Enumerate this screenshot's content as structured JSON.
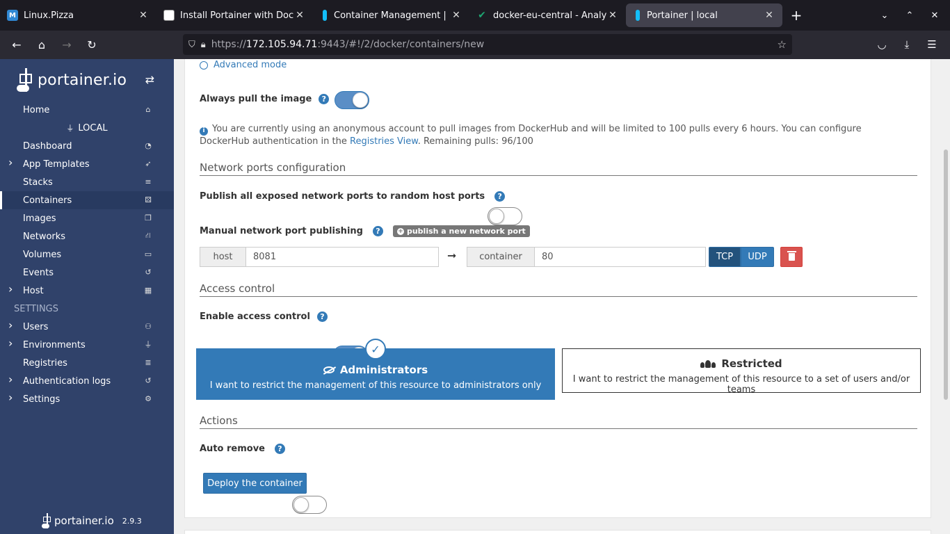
{
  "browser": {
    "tabs": [
      {
        "title": "Linux.Pizza",
        "favicon": "M",
        "favicon_color": "#3088d4",
        "active": false
      },
      {
        "title": "Install Portainer with Dock",
        "favicon": "",
        "favicon_color": "#ffffff",
        "active": false
      },
      {
        "title": "Container Management | ",
        "favicon": "",
        "favicon_color": "#13bef9",
        "active": false
      },
      {
        "title": "docker-eu-central - Analytic",
        "favicon": "",
        "favicon_color": "#1ea672",
        "active": false
      },
      {
        "title": "Portainer | local",
        "favicon": "",
        "favicon_color": "#13bef9",
        "active": true
      }
    ],
    "url_prefix": "https://",
    "url_host": "172.105.94.71",
    "url_rest": ":9443/#!/2/docker/containers/new"
  },
  "sidebar": {
    "logo_text": "portainer.io",
    "home": "Home",
    "environment": "LOCAL",
    "items": [
      {
        "label": "Dashboard",
        "icon": "dashboard-icon",
        "chevron": false,
        "active": false
      },
      {
        "label": "App Templates",
        "icon": "rocket-icon",
        "chevron": true,
        "active": false
      },
      {
        "label": "Stacks",
        "icon": "list-icon",
        "chevron": false,
        "active": false
      },
      {
        "label": "Containers",
        "icon": "cubes-icon",
        "chevron": false,
        "active": true
      },
      {
        "label": "Images",
        "icon": "clone-icon",
        "chevron": false,
        "active": false
      },
      {
        "label": "Networks",
        "icon": "sitemap-icon",
        "chevron": false,
        "active": false
      },
      {
        "label": "Volumes",
        "icon": "hdd-icon",
        "chevron": false,
        "active": false
      },
      {
        "label": "Events",
        "icon": "history-icon",
        "chevron": false,
        "active": false
      },
      {
        "label": "Host",
        "icon": "th-icon",
        "chevron": true,
        "active": false
      }
    ],
    "settings_heading": "SETTINGS",
    "settings_items": [
      {
        "label": "Users",
        "icon": "users-icon",
        "chevron": true
      },
      {
        "label": "Environments",
        "icon": "plug-icon",
        "chevron": true
      },
      {
        "label": "Registries",
        "icon": "database-icon",
        "chevron": false
      },
      {
        "label": "Authentication logs",
        "icon": "history-icon",
        "chevron": true
      },
      {
        "label": "Settings",
        "icon": "cogs-icon",
        "chevron": true
      }
    ],
    "footer_logo": "portainer.io",
    "version": "2.9.3"
  },
  "form": {
    "advanced_mode": "Advanced mode",
    "always_pull_label": "Always pull the image",
    "always_pull": true,
    "info_text": "You are currently using an anonymous account to pull images from DockerHub and will be limited to 100 pulls every 6 hours. You can configure DockerHub authentication in the ",
    "info_link": "Registries View",
    "info_remaining": ". Remaining pulls: 96/100",
    "network_section": "Network ports configuration",
    "publish_all_label": "Publish all exposed network ports to random host ports",
    "publish_all": false,
    "manual_label": "Manual network port publishing",
    "publish_new_button": "publish a new network port",
    "port": {
      "host_label": "host",
      "host_value": "8081",
      "container_label": "container",
      "container_value": "80",
      "tcp": "TCP",
      "udp": "UDP",
      "protocol_selected": "TCP"
    },
    "access_section": "Access control",
    "enable_access_label": "Enable access control",
    "enable_access": true,
    "admin_title": "Administrators",
    "admin_desc": "I want to restrict the management of this resource to administrators only",
    "restricted_title": "Restricted",
    "restricted_desc": "I want to restrict the management of this resource to a set of users and/or teams",
    "actions_section": "Actions",
    "auto_remove_label": "Auto remove",
    "auto_remove": false,
    "deploy_button": "Deploy the container"
  }
}
